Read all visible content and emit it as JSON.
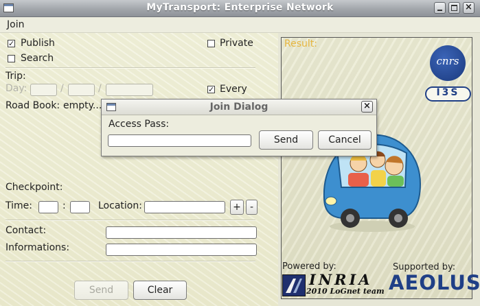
{
  "window": {
    "title": "MyTransport: Enterprise Network"
  },
  "menu": {
    "join": "Join"
  },
  "form": {
    "publish": {
      "label": "Publish",
      "checked": true
    },
    "private": {
      "label": "Private",
      "checked": false
    },
    "search": {
      "label": "Search",
      "checked": false
    },
    "trip_label": "Trip:",
    "day_label": "Day:",
    "date_sep1": "/",
    "date_sep2": "/",
    "every": {
      "label": "Every",
      "checked": true
    },
    "roadbook_label": "Road Book:",
    "roadbook_value": "empty...",
    "checkpoint_label": "Checkpoint:",
    "time_label": "Time:",
    "time_sep": ":",
    "location_label": "Location:",
    "add_label": "+",
    "remove_label": "-",
    "contact_label": "Contact:",
    "informations_label": "Informations:",
    "send_label": "Send",
    "clear_label": "Clear"
  },
  "result": {
    "label": "Result:",
    "logos": {
      "cnrs": "cnrs",
      "i3s": "I3S",
      "powered_by": "Powered by:",
      "inria": "INRIA",
      "team": "2010 LoGnet team",
      "supported_by": "Supported by:",
      "aeolus": "AEOLUS"
    }
  },
  "dialog": {
    "title": "Join Dialog",
    "access_pass_label": "Access Pass:",
    "access_pass_value": "",
    "send_label": "Send",
    "cancel_label": "Cancel"
  },
  "colors": {
    "accent_result": "#e6b640",
    "logo_blue": "#1f3f86",
    "car_blue": "#3d8fcf"
  }
}
